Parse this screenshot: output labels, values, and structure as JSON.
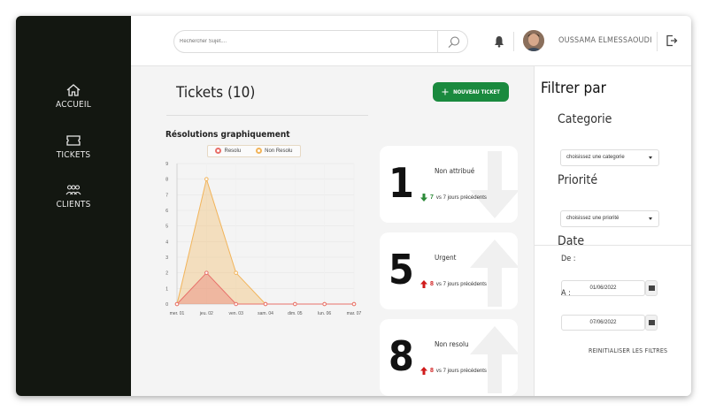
{
  "sidebar": {
    "items": [
      {
        "label": "ACCUEIL",
        "icon": "home-icon"
      },
      {
        "label": "TICKETS",
        "icon": "ticket-icon"
      },
      {
        "label": "CLIENTS",
        "icon": "users-icon"
      }
    ]
  },
  "header": {
    "search_placeholder": "Rechercher Sujet....",
    "username": "OUSSAMA ELMESSAOUDI"
  },
  "main": {
    "title": "Tickets (10)",
    "new_ticket_label": "NOUVEAU TICKET",
    "chart_title": "Résolutions graphiquement"
  },
  "stats": [
    {
      "number": "1",
      "label": "Non attribué",
      "delta": "7",
      "delta_text": "vs 7 jours précédents",
      "direction": "down",
      "color": "#2e8b3a"
    },
    {
      "number": "5",
      "label": "Urgent",
      "delta": "8",
      "delta_text": "vs 7 jours précédents",
      "direction": "up",
      "color": "#d01b1b"
    },
    {
      "number": "8",
      "label": "Non resolu",
      "delta": "8",
      "delta_text": "vs 7 jours précédents",
      "direction": "up",
      "color": "#d01b1b"
    }
  ],
  "filters": {
    "title": "Filtrer par",
    "category_label": "Categorie",
    "category_value": "choisissez une categorie",
    "priority_label": "Priorité",
    "priority_value": "choisissez une priorité",
    "date_label": "Date",
    "from_label": "De :",
    "from_value": "01/06/2022",
    "to_label": "A :",
    "to_value": "07/06/2022",
    "reset_label": "REINITIALISER LES FILTRES"
  },
  "colors": {
    "sidebar_bg": "#131711",
    "accent_green": "#1a8a3e",
    "resolu": "#e8706a",
    "non_resolu": "#f2b45a"
  },
  "chart_data": {
    "type": "area",
    "title": "Résolutions graphiquement",
    "categories": [
      "mer. 01",
      "jeu. 02",
      "ven. 03",
      "sam. 04",
      "dim. 05",
      "lun. 06",
      "mar. 07"
    ],
    "series": [
      {
        "name": "Resolu",
        "values": [
          0,
          2,
          0,
          0,
          0,
          0,
          0
        ],
        "color": "#e8706a"
      },
      {
        "name": "Non Resolu",
        "values": [
          0,
          8,
          2,
          0,
          0,
          0,
          0
        ],
        "color": "#f2b45a"
      }
    ],
    "yticks": [
      "0",
      "1",
      "2",
      "3",
      "4",
      "5",
      "6",
      "7",
      "8",
      "9"
    ],
    "ylim": [
      0,
      9
    ],
    "grid": true,
    "legend": "top"
  }
}
